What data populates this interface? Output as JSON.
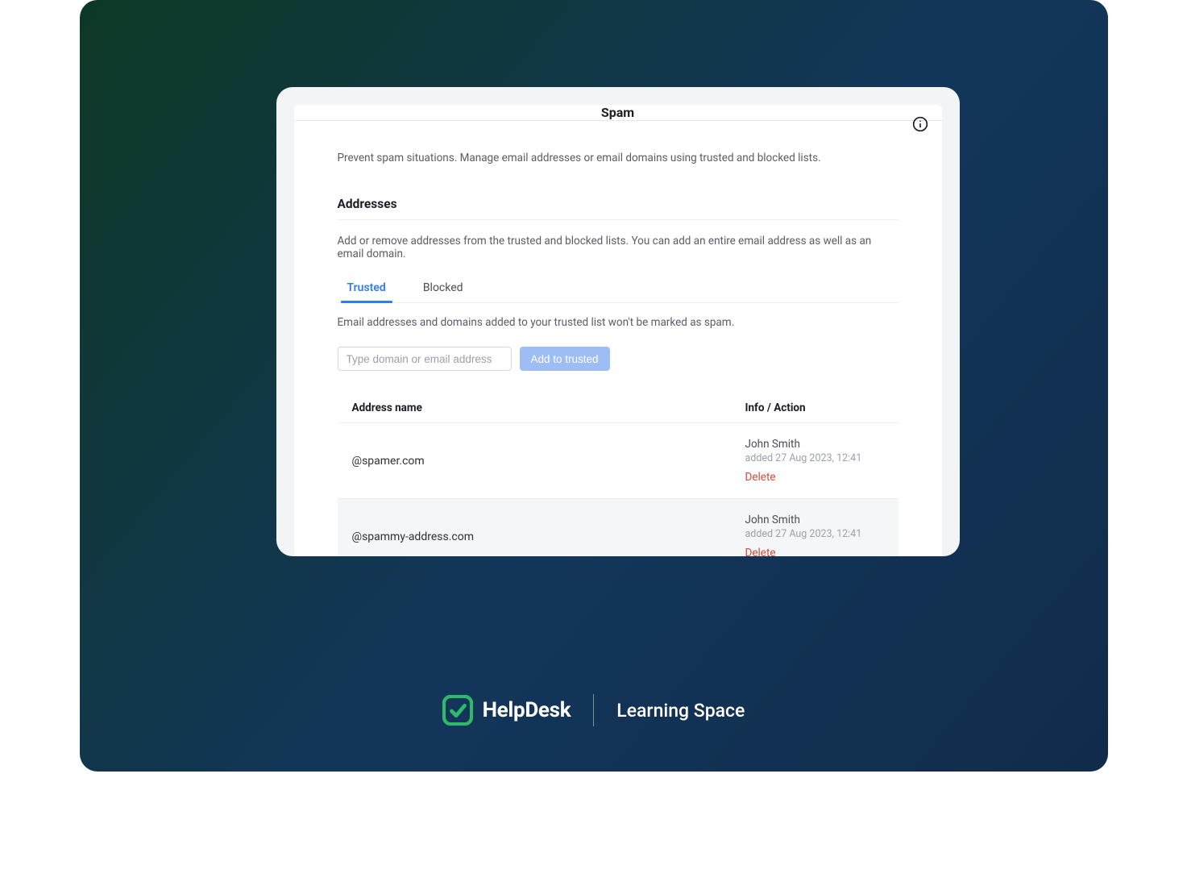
{
  "page": {
    "title": "Spam",
    "lead": "Prevent spam situations. Manage email addresses or email domains using trusted and blocked lists.",
    "section_title": "Addresses",
    "section_sub": "Add or remove addresses from the trusted and blocked lists. You can add an entire email address as well as an email domain.",
    "tab_desc": "Email addresses and domains added to your trusted list won't be marked as spam."
  },
  "tabs": {
    "trusted": "Trusted",
    "blocked": "Blocked"
  },
  "input": {
    "placeholder": "Type domain or email address",
    "add_label": "Add to trusted"
  },
  "table": {
    "col_name": "Address name",
    "col_action": "Info / Action",
    "delete": "Delete",
    "rows": [
      {
        "address": "@spamer.com",
        "who": "John Smith",
        "when": "added 27 Aug 2023, 12:41"
      },
      {
        "address": "@spammy-address.com",
        "who": "John Smith",
        "when": "added 27 Aug 2023, 12:41"
      }
    ]
  },
  "footer": {
    "brand": "HelpDesk",
    "sub": "Learning Space"
  }
}
